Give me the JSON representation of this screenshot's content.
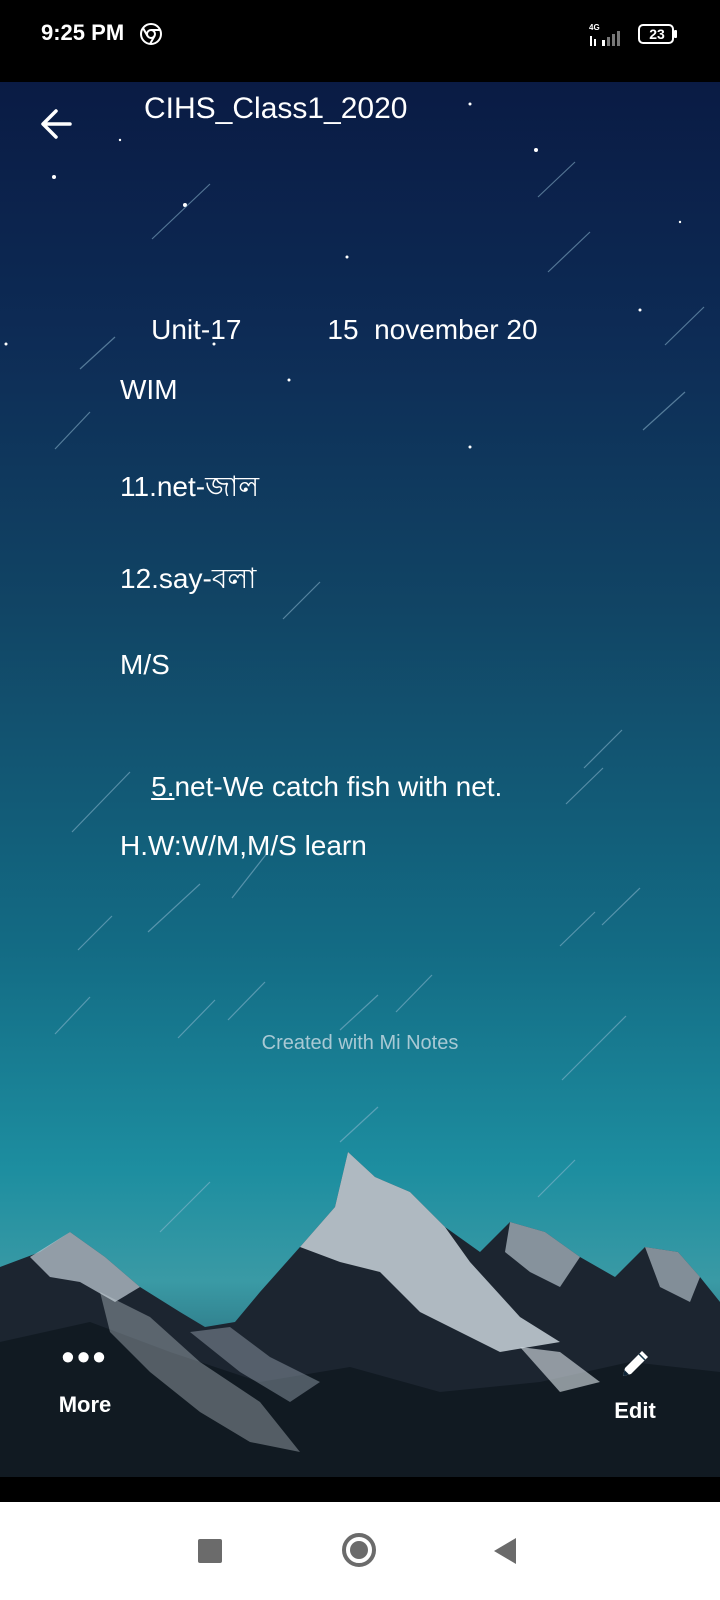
{
  "status_bar": {
    "time": "9:25 PM",
    "network": "4G",
    "battery": "23"
  },
  "header": {
    "title": "CIHS_Class1_2020"
  },
  "note": {
    "line1_unit": "Unit-17",
    "line1_date": "15  november 20",
    "line2": "WIM",
    "line3": "11.net-জাল",
    "line4": "12.say-বলা",
    "line5": "M/S",
    "line6_num": "5.",
    "line6_text": "net-We catch fish with net.",
    "line7": "H.W:W/M,M/S learn"
  },
  "footer": {
    "credit": "Created with Mi Notes"
  },
  "actions": {
    "more_label": "More",
    "edit_label": "Edit"
  },
  "icons": {
    "back": "back-arrow-icon",
    "more": "more-dots-icon",
    "edit": "pencil-icon",
    "chrome": "chrome-icon",
    "signal": "signal-icon",
    "battery": "battery-icon"
  }
}
